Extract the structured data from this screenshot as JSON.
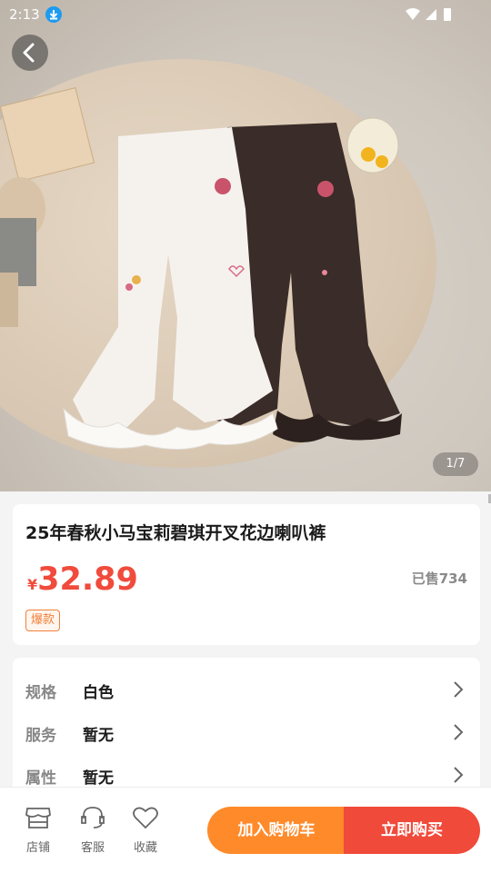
{
  "status": {
    "time": "2:13"
  },
  "gallery": {
    "counter": "1/7"
  },
  "product": {
    "title": "25年春秋小马宝莉碧琪开叉花边喇叭裤",
    "currency": "¥",
    "price": "32.89",
    "sold": "已售734",
    "badge": "爆款"
  },
  "specs": [
    {
      "label": "规格",
      "value": "白色"
    },
    {
      "label": "服务",
      "value": "暂无"
    },
    {
      "label": "属性",
      "value": "暂无"
    }
  ],
  "bottom": {
    "tabs": [
      {
        "icon": "store-icon",
        "label": "店铺"
      },
      {
        "icon": "headset-icon",
        "label": "客服"
      },
      {
        "icon": "heart-icon",
        "label": "收藏"
      }
    ],
    "add_to_cart": "加入购物车",
    "buy_now": "立即购买"
  },
  "colors": {
    "accent": "#f04b3c",
    "orange": "#ff8a2a"
  }
}
